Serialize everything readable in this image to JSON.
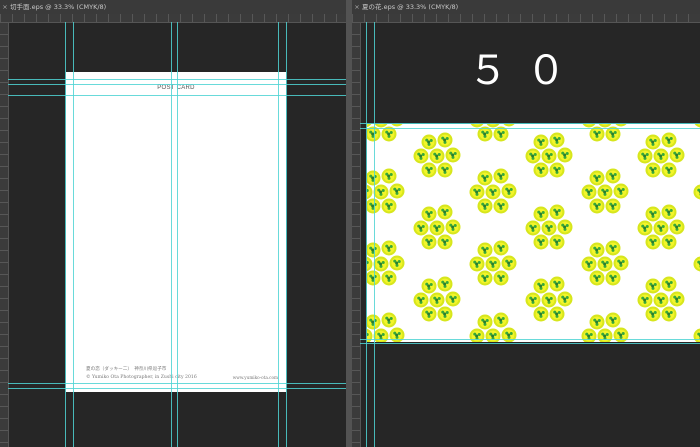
{
  "left_document": {
    "tab_title": "切手面.eps @ 33.3% (CMYK/8)",
    "close_glyph": "×",
    "postcard": {
      "heading": "POST CARD",
      "footer_line1": "夏の恋（ダッキー二）　神奈川県逗子市",
      "footer_line2": "© Yumiko Ota Photographer, in Zushi city 2016",
      "footer_url": "www.yumiko-ota.com"
    }
  },
  "right_document": {
    "tab_title": "夏の花.eps @ 33.3% (CMYK/8)",
    "close_glyph": "×",
    "big_number": "５０",
    "pattern": {
      "description_colors": {
        "outer_ring": "#d7e61d",
        "flower_bg": "#f2f52a",
        "dot_green": "#36a83a",
        "dark_green": "#2a7d30"
      }
    }
  },
  "colors": {
    "workspace": "#262626",
    "guide": "#4fd3d3",
    "tabbar": "#3a3a3a"
  }
}
